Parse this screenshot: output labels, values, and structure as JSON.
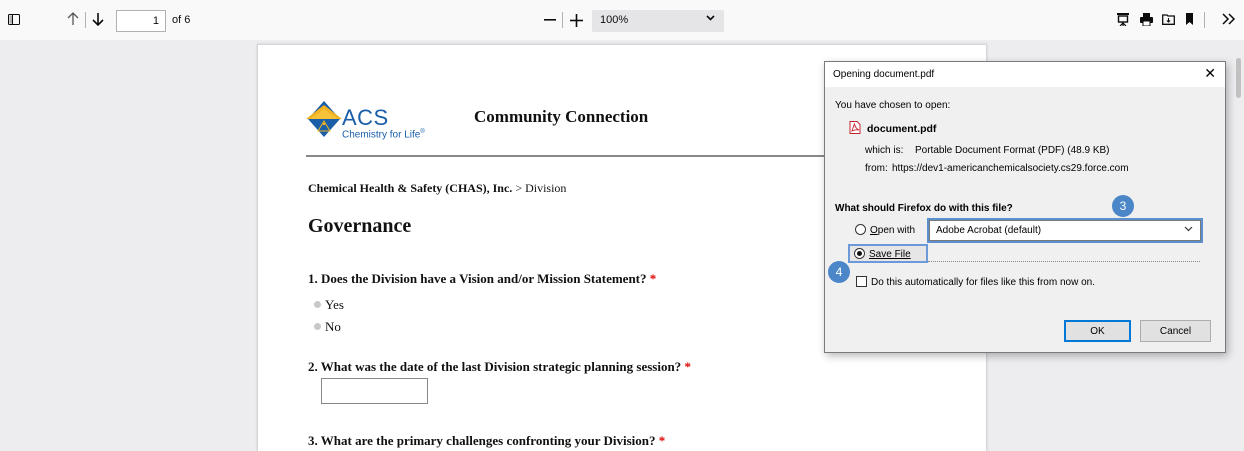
{
  "toolbar": {
    "page_number": "1",
    "page_of": "of 6",
    "zoom_value": "100%",
    "icons": [
      "sidebar-toggle-icon",
      "arrow-up-icon",
      "arrow-down-icon",
      "minus-icon",
      "plus-icon",
      "presentation-icon",
      "print-icon",
      "download-icon",
      "bookmark-icon",
      "chevron-double-right-icon"
    ]
  },
  "document": {
    "logo_text": "ACS",
    "logo_tagline": "Chemistry for Life",
    "logo_tagline_mark": "®",
    "header_title": "Community Connection",
    "breadcrumb_bold": "Chemical Health & Safety (CHAS), Inc.",
    "breadcrumb_rest": " > Division",
    "heading": "Governance",
    "questions": [
      {
        "text": "1. Does the Division have a Vision and/or Mission Statement?",
        "required": "*"
      },
      {
        "text": "2. What was the date of the last Division strategic planning session?",
        "required": "*"
      },
      {
        "text": "3. What are the primary challenges confronting your Division?",
        "required": "*"
      }
    ],
    "options": [
      "Yes",
      "No"
    ]
  },
  "dialog": {
    "title": "Opening document.pdf",
    "close": "✕",
    "intro": "You have chosen to open:",
    "filename": "document.pdf",
    "which_is_label": "which is:",
    "which_is_value": "Portable Document Format (PDF) (48.9 KB)",
    "from_label": "from:",
    "from_value": "https://dev1-americanchemicalsociety.cs29.force.com",
    "question": "What should Firefox do with this file?",
    "open_with_label": "Open with",
    "open_with_app": "Adobe Acrobat (default)",
    "save_file_label": "Save File",
    "auto_label": "Do this automatically for files like this from now on.",
    "ok": "OK",
    "cancel": "Cancel"
  },
  "annotations": {
    "badge_3": "3",
    "badge_4": "4"
  },
  "colors": {
    "accent": "#4a86c8",
    "link_blue": "#1a5ea8",
    "required": "#dd0000"
  }
}
